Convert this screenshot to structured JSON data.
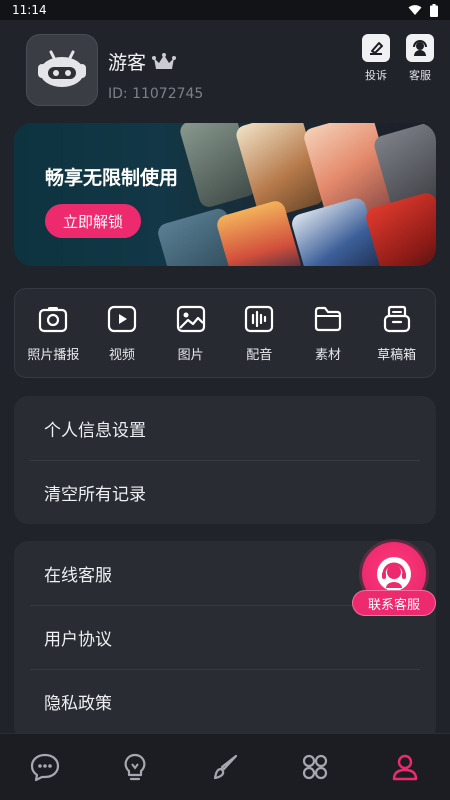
{
  "status": {
    "time": "11:14"
  },
  "profile": {
    "name": "游客",
    "id_text": "ID: 11072745",
    "actions": [
      {
        "label": "投诉",
        "icon": "report-icon"
      },
      {
        "label": "客服",
        "icon": "customer-service-icon"
      }
    ]
  },
  "banner": {
    "title": "畅享无限制使用",
    "button": "立即解锁"
  },
  "tools": [
    {
      "label": "照片播报",
      "icon": "camera-icon"
    },
    {
      "label": "视频",
      "icon": "video-play-icon"
    },
    {
      "label": "图片",
      "icon": "image-icon"
    },
    {
      "label": "配音",
      "icon": "audio-wave-icon"
    },
    {
      "label": "素材",
      "icon": "folder-icon"
    },
    {
      "label": "草稿箱",
      "icon": "draft-box-icon"
    }
  ],
  "settings_group_1": [
    "个人信息设置",
    "清空所有记录"
  ],
  "settings_group_2": [
    "在线客服",
    "用户协议",
    "隐私政策"
  ],
  "floating_service": {
    "label": "联系客服"
  },
  "tabbar": [
    {
      "icon": "chat-bubble-icon",
      "active": false
    },
    {
      "icon": "lightbulb-icon",
      "active": false
    },
    {
      "icon": "brush-icon",
      "active": false
    },
    {
      "icon": "apps-grid-icon",
      "active": false
    },
    {
      "icon": "person-icon",
      "active": true
    }
  ],
  "colors": {
    "accent": "#ee2a6f",
    "background": "#202329",
    "card": "#292c33"
  }
}
